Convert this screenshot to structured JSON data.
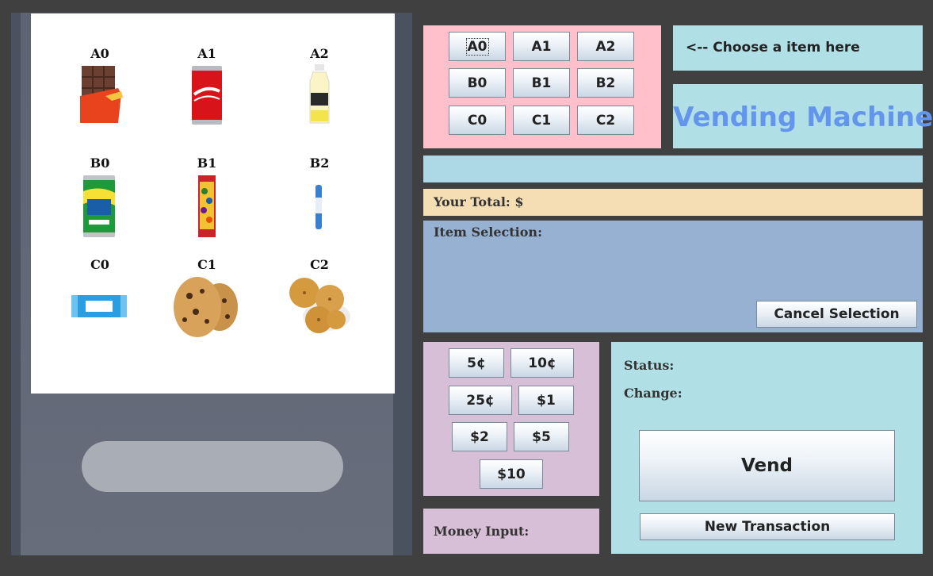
{
  "window": {
    "slots": [
      {
        "label": "A0"
      },
      {
        "label": "A1"
      },
      {
        "label": "A2"
      },
      {
        "label": "B0"
      },
      {
        "label": "B1"
      },
      {
        "label": "B2"
      },
      {
        "label": "C0"
      },
      {
        "label": "C1"
      },
      {
        "label": "C2"
      }
    ]
  },
  "selection_buttons": [
    "A0",
    "A1",
    "A2",
    "B0",
    "B1",
    "B2",
    "C0",
    "C1",
    "C2"
  ],
  "hint": "<-- Choose a item here",
  "title": "Vending Machine",
  "message": "",
  "total": {
    "label": "Your Total: $"
  },
  "item_selection": {
    "label": "Item Selection:",
    "cancel_label": "Cancel Selection"
  },
  "money_buttons": [
    "5¢",
    "10¢",
    "25¢",
    "$1",
    "$2",
    "$5",
    "$10"
  ],
  "money_input": {
    "label": "Money Input:"
  },
  "status": {
    "status_label": "Status:",
    "change_label": "Change:",
    "vend_label": "Vend",
    "new_label": "New Transaction"
  },
  "colors": {
    "select_panel": "#ffc0cb",
    "info_panel": "#b0e0e6",
    "total_panel": "#f5deb3",
    "selection_panel": "#97b1d2",
    "money_panel": "#d8bfd8",
    "title_text": "#6495ed"
  },
  "icons": [
    "chocolate-bar-icon",
    "cola-can-icon",
    "lemonade-bottle-icon",
    "soda-can-icon",
    "candy-pack-icon",
    "mints-roll-icon",
    "snack-bar-icon",
    "cookies-icon",
    "crackers-icon"
  ]
}
